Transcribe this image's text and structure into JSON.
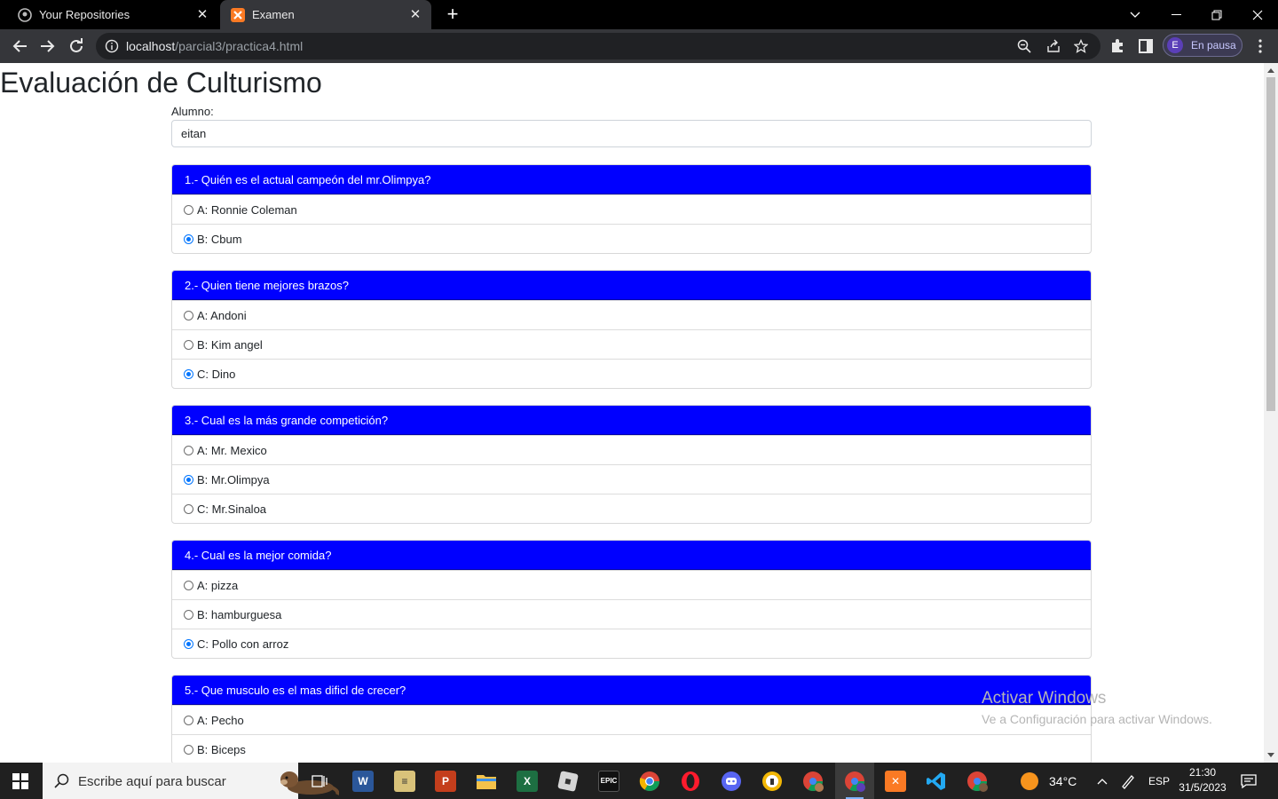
{
  "browser": {
    "tabs": [
      {
        "label": "Your Repositories",
        "icon": "github-icon",
        "active": false
      },
      {
        "label": "Examen",
        "icon": "xampp-icon",
        "active": true
      }
    ],
    "url_host": "localhost",
    "url_path": "/parcial3/practica4.html",
    "profile_initial": "E",
    "profile_label": "En pausa"
  },
  "page": {
    "title": "Evaluación de Culturismo",
    "student_label": "Alumno:",
    "student_value": "eitan"
  },
  "questions": [
    {
      "header": "1.- Quién es el actual campeón del mr.Olimpya?",
      "options": [
        {
          "label": "A: Ronnie Coleman",
          "checked": false
        },
        {
          "label": "B: Cbum",
          "checked": true
        }
      ]
    },
    {
      "header": "2.- Quien tiene mejores brazos?",
      "options": [
        {
          "label": "A: Andoni",
          "checked": false
        },
        {
          "label": "B: Kim angel",
          "checked": false
        },
        {
          "label": "C: Dino",
          "checked": true
        }
      ]
    },
    {
      "header": "3.- Cual es la más grande competición?",
      "options": [
        {
          "label": "A: Mr. Mexico",
          "checked": false
        },
        {
          "label": "B: Mr.Olimpya",
          "checked": true
        },
        {
          "label": "C: Mr.Sinaloa",
          "checked": false
        }
      ]
    },
    {
      "header": "4.- Cual es la mejor comida?",
      "options": [
        {
          "label": "A: pizza",
          "checked": false
        },
        {
          "label": "B: hamburguesa",
          "checked": false
        },
        {
          "label": "C: Pollo con arroz",
          "checked": true
        }
      ]
    },
    {
      "header": "5.- Que musculo es el mas dificl de crecer?",
      "options": [
        {
          "label": "A: Pecho",
          "checked": false
        },
        {
          "label": "B: Biceps",
          "checked": false
        }
      ]
    }
  ],
  "watermark": {
    "line1": "Activar Windows",
    "line2": "Ve a Configuración para activar Windows."
  },
  "taskbar": {
    "search_placeholder": "Escribe aquí para buscar",
    "temperature": "34°C",
    "language": "ESP",
    "time": "21:30",
    "date": "31/5/2023"
  },
  "colors": {
    "question_header": "#0000ff",
    "radio_checked": "#0075ff"
  }
}
